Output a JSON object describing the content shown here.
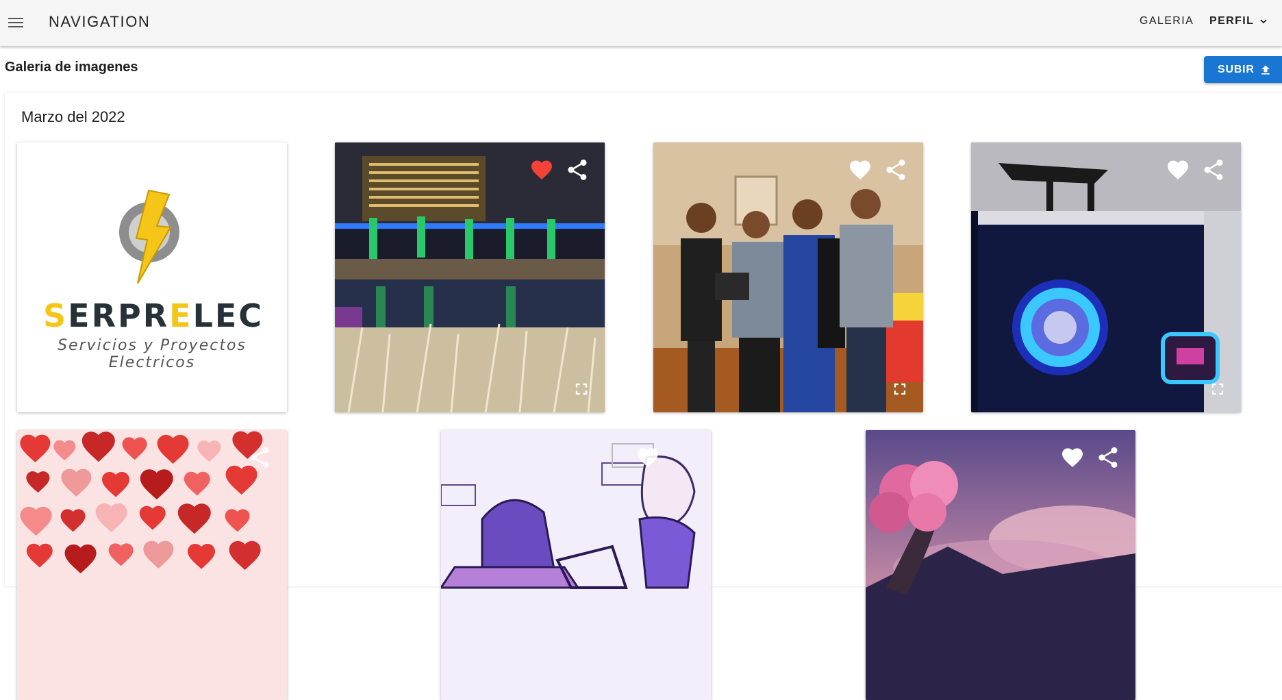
{
  "appbar": {
    "title": "NAVIGATION",
    "nav": {
      "galeria": "GALERIA",
      "perfil": "PERFIL"
    }
  },
  "page": {
    "heading": "Galeria de imagenes",
    "upload_label": "SUBIR"
  },
  "gallery": {
    "section_title": "Marzo del 2022",
    "logo": {
      "brand_parts": [
        "S",
        "ERPR",
        "E",
        "LEC"
      ],
      "subtitle": "Servicios y Proyectos Electricos"
    },
    "cards": [
      {
        "name": "logo-card",
        "favorite": false
      },
      {
        "name": "night-lake-card",
        "favorite": true
      },
      {
        "name": "family-party-card",
        "favorite": false
      },
      {
        "name": "pc-case-card",
        "favorite": false
      },
      {
        "name": "hearts-card",
        "favorite": false
      },
      {
        "name": "anime-sketch-card",
        "favorite": false
      },
      {
        "name": "cherry-tree-card",
        "favorite": false
      }
    ]
  },
  "colors": {
    "accent": "#1976d2",
    "favorite_heart": "#f44336",
    "appbar_bg": "#f5f5f5"
  },
  "icons": [
    "menu-icon",
    "chevron-down-icon",
    "upload-icon",
    "heart-icon",
    "share-icon",
    "fullscreen-icon"
  ]
}
